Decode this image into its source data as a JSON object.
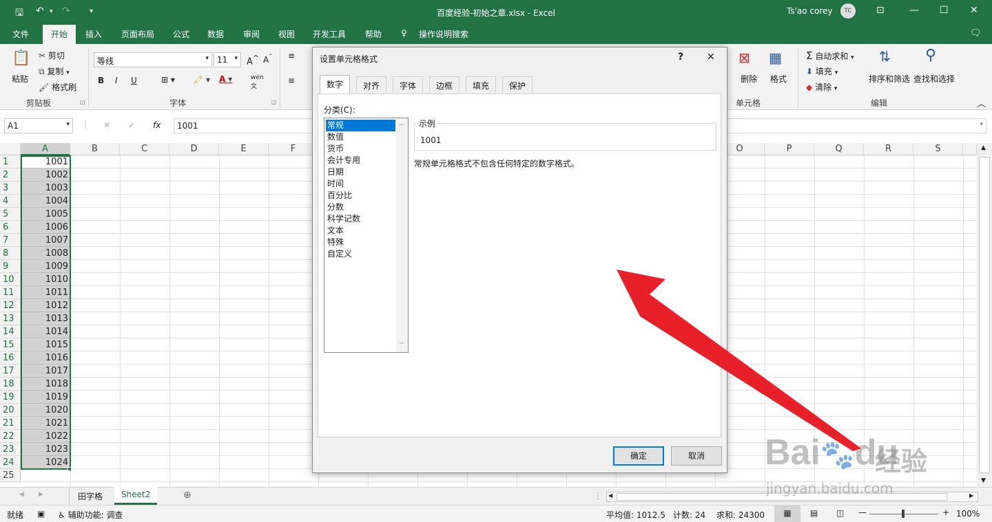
{
  "window": {
    "title": "百度经验-初始之章.xlsx  -  Excel",
    "user": "Ts'ao corey",
    "avatar": "TC"
  },
  "menu": {
    "tabs": [
      "文件",
      "开始",
      "插入",
      "页面布局",
      "公式",
      "数据",
      "审阅",
      "视图",
      "开发工具",
      "帮助",
      "操作说明搜索"
    ]
  },
  "ribbon": {
    "clipboard": {
      "paste": "粘贴",
      "cut": "剪切",
      "copy": "复制",
      "painter": "格式刷",
      "group": "剪贴板"
    },
    "font": {
      "name": "等线",
      "size": "11",
      "group": "字体",
      "bold": "B",
      "italic": "I",
      "underline": "U"
    },
    "cells": {
      "delete": "删除",
      "format": "格式",
      "group": "单元格"
    },
    "editing": {
      "autosum": "自动求和",
      "fill": "填充",
      "clear": "清除",
      "sort": "排序和筛选",
      "find": "查找和选择",
      "group": "编辑"
    }
  },
  "formula_bar": {
    "name_box": "A1",
    "value": "1001",
    "fx": "fx"
  },
  "columns": [
    "A",
    "B",
    "C",
    "D",
    "E",
    "F",
    "O",
    "P",
    "Q",
    "R",
    "S"
  ],
  "rows": [
    {
      "n": "1",
      "v": "1001"
    },
    {
      "n": "2",
      "v": "1002"
    },
    {
      "n": "3",
      "v": "1003"
    },
    {
      "n": "4",
      "v": "1004"
    },
    {
      "n": "5",
      "v": "1005"
    },
    {
      "n": "6",
      "v": "1006"
    },
    {
      "n": "7",
      "v": "1007"
    },
    {
      "n": "8",
      "v": "1008"
    },
    {
      "n": "9",
      "v": "1009"
    },
    {
      "n": "10",
      "v": "1010"
    },
    {
      "n": "11",
      "v": "1011"
    },
    {
      "n": "12",
      "v": "1012"
    },
    {
      "n": "13",
      "v": "1013"
    },
    {
      "n": "14",
      "v": "1014"
    },
    {
      "n": "15",
      "v": "1015"
    },
    {
      "n": "16",
      "v": "1016"
    },
    {
      "n": "17",
      "v": "1017"
    },
    {
      "n": "18",
      "v": "1018"
    },
    {
      "n": "19",
      "v": "1019"
    },
    {
      "n": "20",
      "v": "1020"
    },
    {
      "n": "21",
      "v": "1021"
    },
    {
      "n": "22",
      "v": "1022"
    },
    {
      "n": "23",
      "v": "1023"
    },
    {
      "n": "24",
      "v": "1024"
    },
    {
      "n": "25",
      "v": ""
    }
  ],
  "sheets": [
    "田字格",
    "Sheet2"
  ],
  "status": {
    "ready": "就绪",
    "accessibility": "辅助功能: 调查",
    "average": "平均值: 1012.5",
    "count": "计数: 24",
    "sum": "求和: 24300",
    "zoom": "100%"
  },
  "dialog": {
    "title": "设置单元格格式",
    "help": "?",
    "close": "✕",
    "tabs": [
      "数字",
      "对齐",
      "字体",
      "边框",
      "填充",
      "保护"
    ],
    "category_label": "分类(C):",
    "categories": [
      "常规",
      "数值",
      "货币",
      "会计专用",
      "日期",
      "时间",
      "百分比",
      "分数",
      "科学记数",
      "文本",
      "特殊",
      "自定义"
    ],
    "sample_label": "示例",
    "sample_value": "1001",
    "description": "常规单元格格式不包含任何特定的数字格式。",
    "ok": "确定",
    "cancel": "取消"
  },
  "watermark": {
    "brand": "Bai",
    "du": "du",
    "jy": "经验",
    "url": "jingyan.baidu.com"
  },
  "colors": {
    "excel_green": "#217346",
    "selection": "#0078d7",
    "arrow": "#e8202a"
  }
}
